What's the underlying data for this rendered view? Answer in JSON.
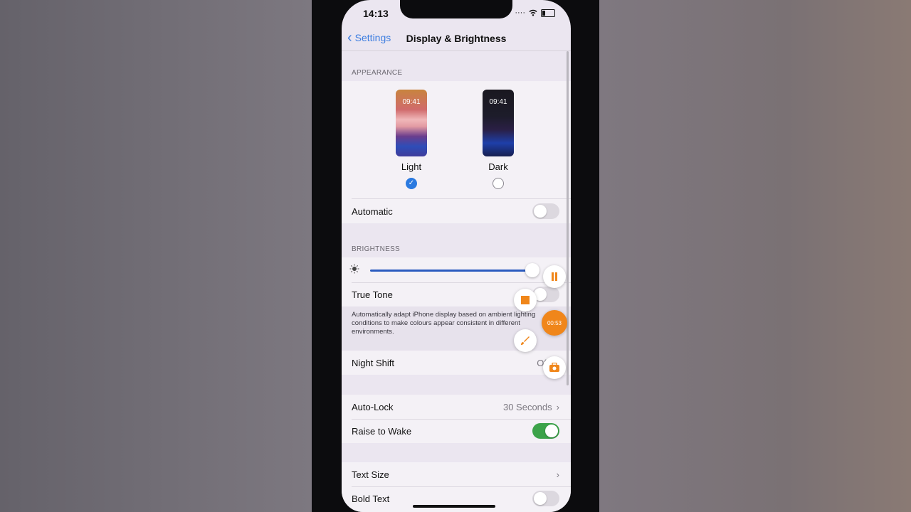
{
  "status": {
    "time": "14:13"
  },
  "nav": {
    "back_label": "Settings",
    "title": "Display & Brightness"
  },
  "appearance": {
    "header": "APPEARANCE",
    "light": {
      "time": "09:41",
      "label": "Light",
      "selected": true
    },
    "dark": {
      "time": "09:41",
      "label": "Dark",
      "selected": false
    },
    "automatic": {
      "label": "Automatic",
      "on": false
    }
  },
  "brightness": {
    "header": "BRIGHTNESS",
    "level": 0.93,
    "true_tone": {
      "label": "True Tone",
      "on": false
    },
    "description": "Automatically adapt iPhone display based on ambient lighting conditions to make colours appear consistent in different environments.",
    "night_shift": {
      "label": "Night Shift",
      "value": "Of"
    }
  },
  "auto_lock": {
    "label": "Auto-Lock",
    "value": "30 Seconds"
  },
  "raise_to_wake": {
    "label": "Raise to Wake",
    "on": true
  },
  "text_size": {
    "label": "Text Size"
  },
  "bold_text": {
    "label": "Bold Text",
    "on": false
  },
  "recorder": {
    "timer": "00:53"
  },
  "colors": {
    "accent": "#3c7de0",
    "toggle_on": "#3ca34a",
    "recorder": "#f0861a"
  }
}
